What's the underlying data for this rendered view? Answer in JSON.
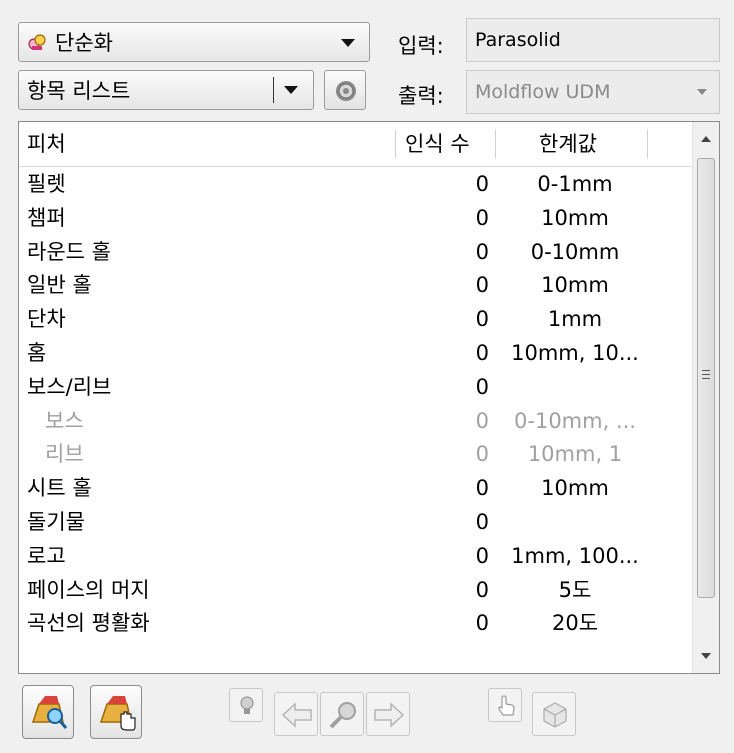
{
  "mode_combo": {
    "label": "단순화",
    "icon": "simplify-icon"
  },
  "list_combo": {
    "label": "항목 리스트"
  },
  "settings_button": {
    "icon": "gear-icon"
  },
  "input": {
    "label": "입력:",
    "value": "Parasolid"
  },
  "output": {
    "label": "출력:",
    "value": "Moldflow UDM"
  },
  "table": {
    "headers": {
      "feature": "피처",
      "count": "인식 수",
      "threshold": "한계값"
    },
    "rows": [
      {
        "feature": "필렛",
        "count": "0",
        "threshold": "0-1mm"
      },
      {
        "feature": "챔퍼",
        "count": "0",
        "threshold": "10mm"
      },
      {
        "feature": "라운드 홀",
        "count": "0",
        "threshold": "0-10mm"
      },
      {
        "feature": "일반 홀",
        "count": "0",
        "threshold": "10mm"
      },
      {
        "feature": "단차",
        "count": "0",
        "threshold": "1mm"
      },
      {
        "feature": "홈",
        "count": "0",
        "threshold": "10mm, 10..."
      },
      {
        "feature": "보스/리브",
        "count": "0",
        "threshold": ""
      },
      {
        "feature": "보스",
        "count": "0",
        "threshold": "0-10mm, ..."
      },
      {
        "feature": "리브",
        "count": "0",
        "threshold": "10mm, 1"
      },
      {
        "feature": "시트 홀",
        "count": "0",
        "threshold": "10mm"
      },
      {
        "feature": "돌기물",
        "count": "0",
        "threshold": ""
      },
      {
        "feature": "로고",
        "count": "0",
        "threshold": "1mm, 100..."
      },
      {
        "feature": "페이스의 머지",
        "count": "0",
        "threshold": "5도"
      },
      {
        "feature": "곡선의 평활화",
        "count": "0",
        "threshold": "20도"
      }
    ]
  },
  "toolbar": {
    "icons": [
      "find-features-icon",
      "select-features-icon",
      "bulb-icon",
      "previous-arrow-icon",
      "magnifier-icon",
      "next-arrow-icon",
      "hand-icon",
      "cube-icon"
    ]
  },
  "colors": {
    "background": "#f0f0f0",
    "subitem_text": "#a0a0a0"
  }
}
